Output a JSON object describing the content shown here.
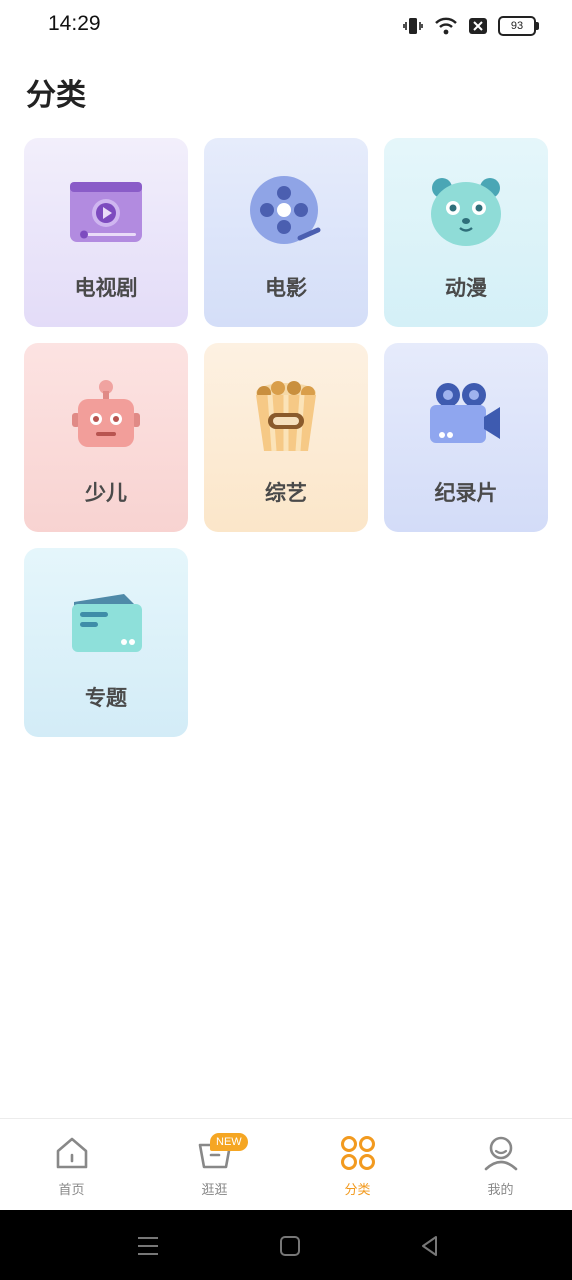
{
  "status": {
    "time": "14:29",
    "battery": "93"
  },
  "page": {
    "title": "分类"
  },
  "categories": [
    {
      "label": "电视剧",
      "icon": "tv-play-icon"
    },
    {
      "label": "电影",
      "icon": "film-reel-icon"
    },
    {
      "label": "动漫",
      "icon": "bear-face-icon"
    },
    {
      "label": "少儿",
      "icon": "robot-icon"
    },
    {
      "label": "综艺",
      "icon": "popcorn-icon"
    },
    {
      "label": "纪录片",
      "icon": "video-camera-icon"
    },
    {
      "label": "专题",
      "icon": "folder-card-icon"
    }
  ],
  "nav": {
    "items": [
      {
        "label": "首页",
        "icon": "home-icon"
      },
      {
        "label": "逛逛",
        "icon": "basket-icon",
        "badge": "NEW"
      },
      {
        "label": "分类",
        "icon": "category-circles-icon",
        "active": true
      },
      {
        "label": "我的",
        "icon": "user-icon"
      }
    ]
  },
  "colors": {
    "accent": "#f29a1f",
    "badge": "#f5a623"
  }
}
